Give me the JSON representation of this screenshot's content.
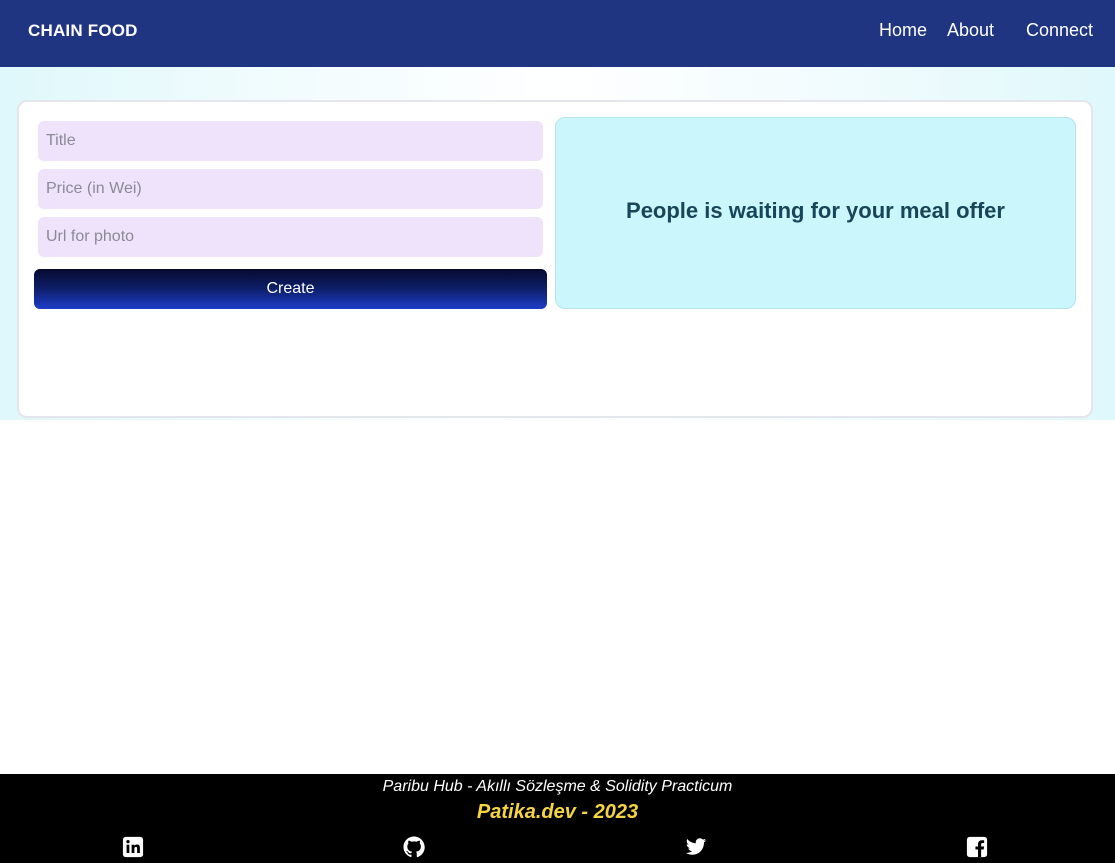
{
  "navbar": {
    "brand": "CHAIN FOOD",
    "links": {
      "home": "Home",
      "about": "About",
      "connect": "Connect"
    }
  },
  "form": {
    "title_placeholder": "Title",
    "price_placeholder": "Price (in Wei)",
    "url_placeholder": "Url for photo",
    "title_value": "",
    "price_value": "",
    "url_value": "",
    "create_label": "Create"
  },
  "offers": {
    "empty_message": "People is waiting for your meal offer"
  },
  "footer": {
    "line1": "Paribu Hub - Akıllı Sözleşme & Solidity Practicum",
    "line2": "Patika.dev - 2023",
    "social_icons": [
      "linkedin-icon",
      "github-icon",
      "twitter-icon",
      "facebook-icon"
    ]
  },
  "colors": {
    "navbar_bg": "#1f3582",
    "input_bg": "#efe3fb",
    "offer_panel_bg": "#cbf6fb",
    "offer_text": "#17465a",
    "footer_bg": "#000000",
    "footer_accent": "#f5d442"
  }
}
